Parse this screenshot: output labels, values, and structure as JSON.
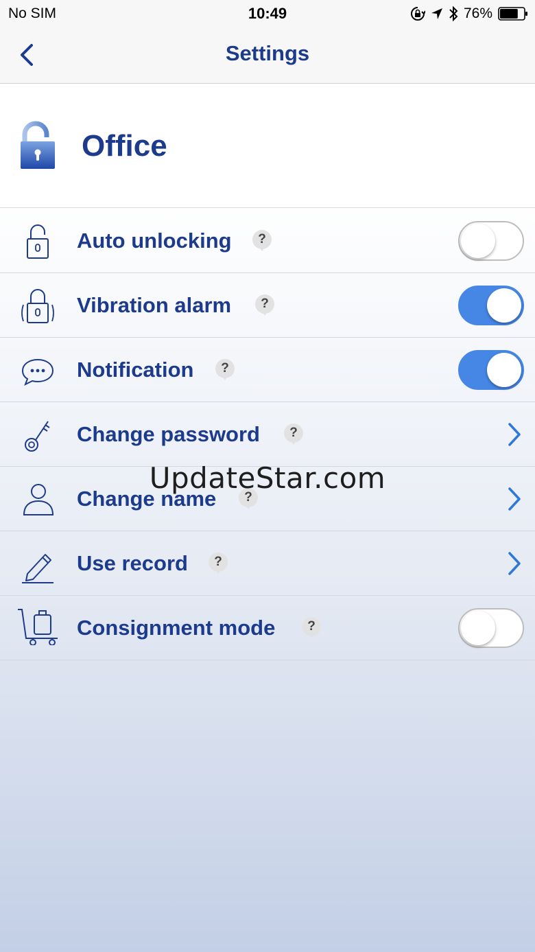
{
  "status_bar": {
    "carrier": "No SIM",
    "time": "10:49",
    "battery_percent": "76%",
    "battery_level": 0.76,
    "icons": [
      "orientation-lock-icon",
      "location-arrow-icon",
      "bluetooth-icon",
      "battery-icon"
    ]
  },
  "nav": {
    "title": "Settings",
    "back_icon": "chevron-left-icon"
  },
  "device": {
    "name": "Office",
    "icon": "padlock-icon"
  },
  "colors": {
    "primary_text": "#1d3b8c",
    "toggle_on": "#4687e6",
    "chevron": "#2f78d8"
  },
  "settings": [
    {
      "label": "Auto unlocking",
      "icon": "unlock-icon",
      "help": "?",
      "control": "toggle",
      "on": false
    },
    {
      "label": "Vibration alarm",
      "icon": "vibrating-lock-icon",
      "help": "?",
      "control": "toggle",
      "on": true
    },
    {
      "label": "Notification",
      "icon": "chat-bubble-icon",
      "help": "?",
      "control": "toggle",
      "on": true
    },
    {
      "label": "Change password",
      "icon": "key-icon",
      "help": "?",
      "control": "chevron"
    },
    {
      "label": "Change name",
      "icon": "person-icon",
      "help": "?",
      "control": "chevron"
    },
    {
      "label": "Use record",
      "icon": "pencil-icon",
      "help": "?",
      "control": "chevron"
    },
    {
      "label": "Consignment mode",
      "icon": "luggage-cart-icon",
      "help": "?",
      "control": "toggle",
      "on": false
    }
  ],
  "watermark": "UpdateStar.com"
}
